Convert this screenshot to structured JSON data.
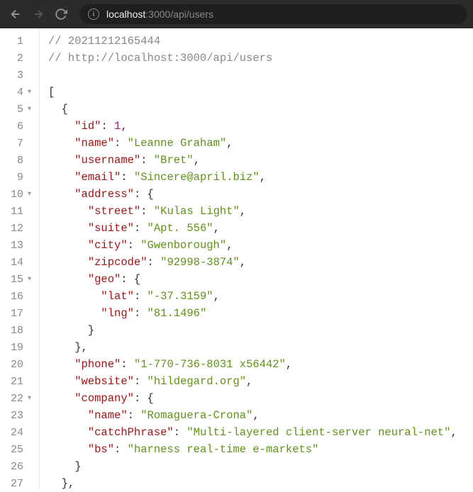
{
  "browser": {
    "url_host": "localhost",
    "url_port": ":3000",
    "url_path": "/api/users"
  },
  "code": {
    "comment_ts": "// 20211212165444",
    "comment_url": "// http://localhost:3000/api/users",
    "lines": [
      {
        "n": 1,
        "fold": ""
      },
      {
        "n": 2,
        "fold": ""
      },
      {
        "n": 3,
        "fold": ""
      },
      {
        "n": 4,
        "fold": "▾"
      },
      {
        "n": 5,
        "fold": "▾"
      },
      {
        "n": 6,
        "fold": ""
      },
      {
        "n": 7,
        "fold": ""
      },
      {
        "n": 8,
        "fold": ""
      },
      {
        "n": 9,
        "fold": ""
      },
      {
        "n": 10,
        "fold": "▾"
      },
      {
        "n": 11,
        "fold": ""
      },
      {
        "n": 12,
        "fold": ""
      },
      {
        "n": 13,
        "fold": ""
      },
      {
        "n": 14,
        "fold": ""
      },
      {
        "n": 15,
        "fold": "▾"
      },
      {
        "n": 16,
        "fold": ""
      },
      {
        "n": 17,
        "fold": ""
      },
      {
        "n": 18,
        "fold": ""
      },
      {
        "n": 19,
        "fold": ""
      },
      {
        "n": 20,
        "fold": ""
      },
      {
        "n": 21,
        "fold": ""
      },
      {
        "n": 22,
        "fold": "▾"
      },
      {
        "n": 23,
        "fold": ""
      },
      {
        "n": 24,
        "fold": ""
      },
      {
        "n": 25,
        "fold": ""
      },
      {
        "n": 26,
        "fold": ""
      },
      {
        "n": 27,
        "fold": ""
      }
    ],
    "json": {
      "id": 1,
      "name": "Leanne Graham",
      "username": "Bret",
      "email": "Sincere@april.biz",
      "address": {
        "street": "Kulas Light",
        "suite": "Apt. 556",
        "city": "Gwenborough",
        "zipcode": "92998-3874",
        "geo": {
          "lat": "-37.3159",
          "lng": "81.1496"
        }
      },
      "phone": "1-770-736-8031 x56442",
      "website": "hildegard.org",
      "company": {
        "name": "Romaguera-Crona",
        "catchPhrase": "Multi-layered client-server neural-net",
        "bs": "harness real-time e-markets"
      }
    }
  }
}
